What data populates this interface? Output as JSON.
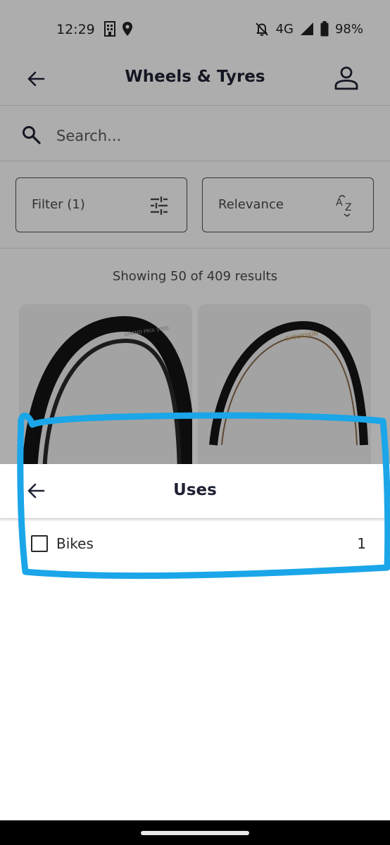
{
  "status_bar": {
    "time": "12:29",
    "network": "4G",
    "battery": "98%"
  },
  "header": {
    "title": "Wheels & Tyres"
  },
  "search": {
    "placeholder": "Search..."
  },
  "filters": {
    "filter_label": "Filter (1)",
    "sort_label": "Relevance"
  },
  "results": {
    "count_text": "Showing 50 of 409 results"
  },
  "product_cards": [
    {
      "image_icon": "road-tyre-black-icon",
      "brand_text": "GRAND PRIX 5000"
    },
    {
      "image_icon": "road-tyre-gatorskin-icon",
      "brand_text": "GATORSKIN"
    }
  ],
  "sheet": {
    "title": "Uses",
    "options": [
      {
        "label": "Bikes",
        "count": "1",
        "checked": false
      }
    ]
  },
  "colors": {
    "accent_annotation": "#1aa6e8",
    "text_primary": "#1e2233",
    "scrim": "rgba(0,0,0,0.32)"
  }
}
